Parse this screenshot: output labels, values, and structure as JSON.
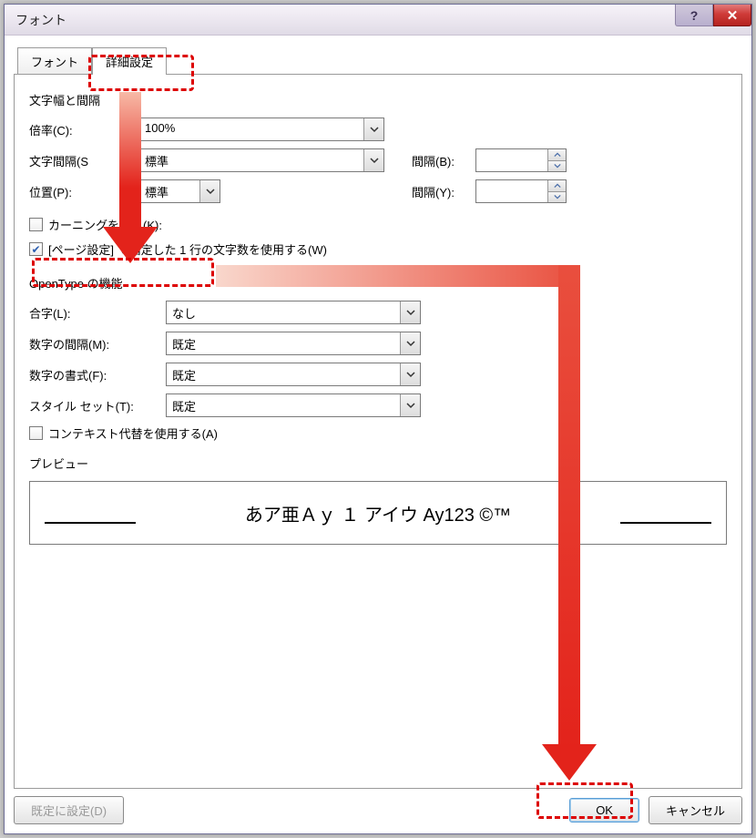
{
  "window": {
    "title": "フォント"
  },
  "tabs": {
    "font": "フォント",
    "advanced": "詳細設定"
  },
  "group_spacing": {
    "title": "文字幅と間隔",
    "scale_label": "倍率(C):",
    "scale_value": "100%",
    "spacing_label": "文字間隔(S",
    "spacing_value": "標準",
    "spacing_by_label": "間隔(B):",
    "position_label": "位置(P):",
    "position_value": "標準",
    "position_by_label": "間隔(Y):",
    "kerning_label": "カーニングを行う(K):",
    "page_chars_label": "[ページ設定] で指定した 1 行の文字数を使用する(W)"
  },
  "group_opentype": {
    "title": "OpenType の機能",
    "ligatures_label": "合字(L):",
    "ligatures_value": "なし",
    "num_spacing_label": "数字の間隔(M):",
    "num_spacing_value": "既定",
    "num_forms_label": "数字の書式(F):",
    "num_forms_value": "既定",
    "style_sets_label": "スタイル セット(T):",
    "style_sets_value": "既定",
    "contextual_label": "コンテキスト代替を使用する(A)"
  },
  "preview": {
    "title": "プレビュー",
    "sample": "あア亜Ａｙ １ アイウ Ay123 ©™"
  },
  "buttons": {
    "set_default": "既定に設定(D)",
    "ok": "OK",
    "cancel": "キャンセル"
  }
}
